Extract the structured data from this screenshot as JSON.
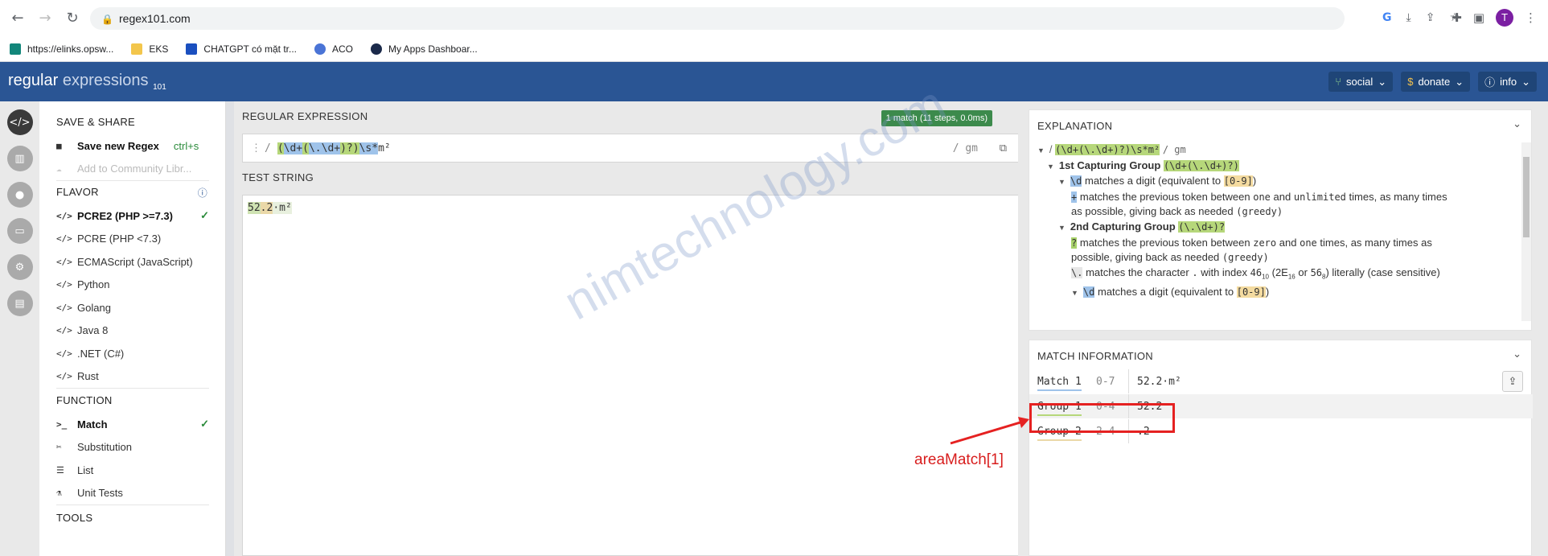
{
  "browser": {
    "url": "regex101.com",
    "avatar_letter": "T",
    "bookmarks": [
      {
        "label": "https://elinks.opsw...",
        "color": "#12867a"
      },
      {
        "label": "EKS",
        "color": "#f3c64c"
      },
      {
        "label": "CHATGPT có mặt tr...",
        "color": "#1a4fbf"
      },
      {
        "label": "ACO",
        "color": "#4a74d6"
      },
      {
        "label": "My Apps Dashboar...",
        "color": "#1b2a4a"
      }
    ]
  },
  "header": {
    "logo_main": "regular",
    "logo_light": "expressions",
    "logo_sub": "101",
    "buttons": [
      {
        "label": "social",
        "icon": "share-icon"
      },
      {
        "label": "donate",
        "icon": "dollar-icon"
      },
      {
        "label": "info",
        "icon": "info-icon"
      }
    ]
  },
  "sidebar": {
    "save_share_title": "SAVE & SHARE",
    "save_label": "Save new Regex",
    "save_shortcut": "ctrl+s",
    "add_library_label": "Add to Community Libr...",
    "flavor_title": "FLAVOR",
    "flavors": [
      "PCRE2 (PHP >=7.3)",
      "PCRE (PHP <7.3)",
      "ECMAScript (JavaScript)",
      "Python",
      "Golang",
      "Java 8",
      ".NET (C#)",
      "Rust"
    ],
    "function_title": "FUNCTION",
    "functions": [
      {
        "label": "Match",
        "icon": ">_"
      },
      {
        "label": "Substitution",
        "icon": "✂"
      },
      {
        "label": "List",
        "icon": "☰"
      },
      {
        "label": "Unit Tests",
        "icon": "⚗"
      }
    ],
    "tools_title": "TOOLS"
  },
  "regex": {
    "section_title": "REGULAR EXPRESSION",
    "match_badge": "1 match (11 steps, 0.0ms)",
    "delimiter": "/",
    "flags": "/ gm",
    "p1": "(",
    "p2": "\\d+",
    "p3": "(",
    "p4": "\\.",
    "p5": "\\d+",
    "p6": ")?)",
    "p7": "\\s*",
    "p8": "m²"
  },
  "test_string": {
    "section_title": "TEST STRING",
    "t1": "52",
    "t2": ".2",
    "t3": "·m²"
  },
  "watermark": "nimtechnology.com",
  "explanation": {
    "title": "EXPLANATION",
    "l1_delim": "/",
    "l1_regex": "(\\d+(\\.\\d+)?)\\s*m²",
    "l1_flags": "/ gm",
    "g1_title": "1st Capturing Group",
    "g1_code": "(\\d+(\\.\\d+)?)",
    "d_token": "\\d",
    "d_text": "matches a digit (equivalent to",
    "d_range": "[0-9]",
    "close_paren": ")",
    "plus_token": "+",
    "plus_text_a": "matches the previous token between",
    "one": "one",
    "and": "and",
    "unlimited": "unlimited",
    "plus_text_b": "times, as many times",
    "as_possible": "as possible, giving back as needed",
    "greedy": "(greedy)",
    "g2_title": "2nd Capturing Group",
    "g2_code": "(\\.\\d+)?",
    "q_token": "?",
    "q_text_a": "matches the previous token between",
    "zero": "zero",
    "q_text_b": "times, as many times as",
    "possible": "possible, giving back as needed",
    "dot_token": "\\.",
    "dot_text_a": "matches the character",
    "dot_char": ".",
    "dot_text_b": "with index",
    "dot_46": "46",
    "dot_sub10": "10",
    "dot_2e": "(2E",
    "dot_sub16": "16",
    "dot_or": "or",
    "dot_56": "56",
    "dot_sub8": "8",
    "dot_text_c": ") literally (case sensitive)",
    "d2_text": "matches a digit (equivalent to"
  },
  "match_info": {
    "title": "MATCH INFORMATION",
    "rows": [
      {
        "name": "Match 1",
        "range": "0-7",
        "value": "52.2·m²",
        "underline": "#9fc3ea"
      },
      {
        "name": "Group 1",
        "range": "0-4",
        "value": "52.2",
        "underline": "#b6d77a"
      },
      {
        "name": "Group 2",
        "range": "2-4",
        "value": ".2",
        "underline": "#ead8a8"
      }
    ]
  },
  "annotation": {
    "label": "areaMatch[1]",
    "color": "#e52121"
  }
}
